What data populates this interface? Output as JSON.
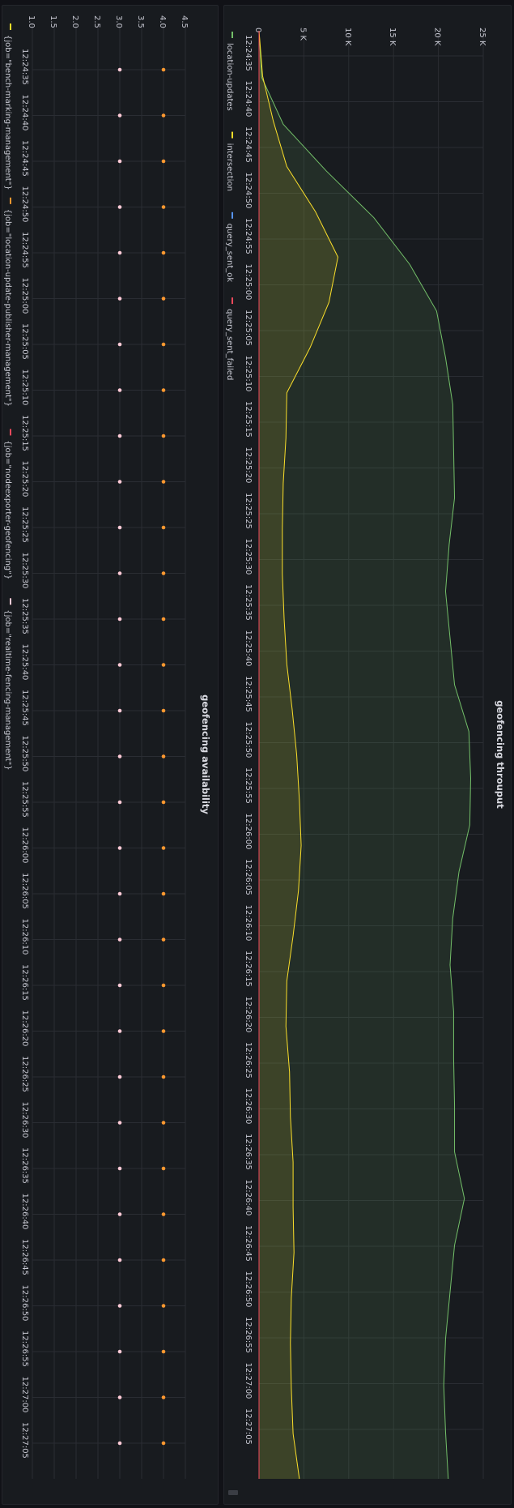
{
  "panels": [
    {
      "title": "geofencing throuput",
      "legend": [
        {
          "label": "location-updates",
          "color": "#73bf69"
        },
        {
          "label": "intersection",
          "color": "#fade2a"
        },
        {
          "label": "query_sent_ok",
          "color": "#5794f2"
        },
        {
          "label": "query_sent_failed",
          "color": "#f2495c"
        }
      ]
    },
    {
      "title": "geofencing availability",
      "legend": [
        {
          "label": "{job=\"bench-marking-management\"}",
          "color": "#fade2a"
        },
        {
          "label": "{job=\"location-update-publisher-management\"}",
          "color": "#ff9830"
        },
        {
          "label": "{job=\"nodeexporter-geofencing\"}",
          "color": "#f2495c"
        },
        {
          "label": "{job=\"realtime-fencing-management\"}",
          "color": "#ffcbd7"
        }
      ]
    }
  ],
  "chart_data": [
    {
      "type": "area",
      "title": "geofencing throuput",
      "x": [
        "12:24:35",
        "12:24:40",
        "12:24:45",
        "12:24:50",
        "12:24:55",
        "12:25:00",
        "12:25:05",
        "12:25:10",
        "12:25:15",
        "12:25:20",
        "12:25:25",
        "12:25:30",
        "12:25:35",
        "12:25:40",
        "12:25:45",
        "12:25:50",
        "12:25:55",
        "12:26:00",
        "12:26:05",
        "12:26:10",
        "12:26:15",
        "12:26:20",
        "12:26:25",
        "12:26:30",
        "12:26:35",
        "12:26:40",
        "12:26:45",
        "12:26:50",
        "12:26:55",
        "12:27:00",
        "12:27:05"
      ],
      "x_ticks": [
        "12:24:35",
        "12:24:40",
        "12:24:45",
        "12:24:50",
        "12:24:55",
        "12:25:00",
        "12:25:05",
        "12:25:10",
        "12:25:15",
        "12:25:20",
        "12:25:25",
        "12:25:30",
        "12:25:35",
        "12:25:40",
        "12:25:45",
        "12:25:50",
        "12:25:55",
        "12:26:00",
        "12:26:05",
        "12:26:10",
        "12:26:15",
        "12:26:20",
        "12:26:25",
        "12:26:30",
        "12:26:35",
        "12:26:40",
        "12:26:45",
        "12:26:50",
        "12:26:55",
        "12:27:00",
        "12:27:05"
      ],
      "y_ticks": [
        "0",
        "5 K",
        "10 K",
        "15 K",
        "20 K",
        "25 K"
      ],
      "ylim": [
        0,
        25000
      ],
      "grid": true,
      "legend_position": "bottom",
      "series": [
        {
          "name": "location-updates",
          "color": "#73bf69",
          "values": [
            0,
            300,
            2700,
            7500,
            12800,
            16800,
            19800,
            20800,
            21600,
            21700,
            21800,
            21200,
            20800,
            21300,
            21800,
            23400,
            23600,
            23500,
            22300,
            21600,
            21300,
            21700,
            21700,
            21800,
            21800,
            22900,
            21800,
            21300,
            20800,
            20600,
            20800,
            21100
          ]
        },
        {
          "name": "intersection",
          "color": "#fade2a",
          "values": [
            0,
            400,
            1600,
            3100,
            6300,
            8800,
            7800,
            5700,
            3100,
            3000,
            2700,
            2600,
            2600,
            2800,
            3100,
            3700,
            4200,
            4500,
            4700,
            4400,
            3800,
            3100,
            3000,
            3400,
            3500,
            3800,
            3800,
            3900,
            3600,
            3500,
            3600,
            3800,
            4500
          ]
        },
        {
          "name": "query_sent_ok",
          "color": "#5794f2",
          "values": []
        },
        {
          "name": "query_sent_failed",
          "color": "#f2495c",
          "values": [
            0,
            0,
            0,
            0,
            0,
            0,
            0,
            0,
            0,
            0,
            0,
            0,
            0,
            0,
            0,
            0,
            0,
            0,
            0,
            0,
            0,
            0,
            0,
            0,
            0,
            0,
            0,
            0,
            0,
            0,
            0,
            0,
            0
          ]
        }
      ]
    },
    {
      "type": "scatter",
      "title": "geofencing availability",
      "x": [
        "12:24:35",
        "12:24:40",
        "12:24:45",
        "12:24:50",
        "12:24:55",
        "12:25:00",
        "12:25:05",
        "12:25:10",
        "12:25:15",
        "12:25:20",
        "12:25:25",
        "12:25:30",
        "12:25:35",
        "12:25:40",
        "12:25:45",
        "12:25:50",
        "12:25:55",
        "12:26:00",
        "12:26:05",
        "12:26:10",
        "12:26:15",
        "12:26:20",
        "12:26:25",
        "12:26:30",
        "12:26:35",
        "12:26:40",
        "12:26:45",
        "12:26:50",
        "12:26:55",
        "12:27:00",
        "12:27:05"
      ],
      "y_ticks": [
        "1.0",
        "1.5",
        "2.0",
        "2.5",
        "3.0",
        "3.5",
        "4.0",
        "4.5"
      ],
      "ylim": [
        1,
        4.5
      ],
      "grid": true,
      "legend_position": "bottom",
      "series": [
        {
          "name": "{job=\"location-update-publisher-management\"}",
          "color": "#ff9830",
          "value": 4
        },
        {
          "name": "{job=\"realtime-fencing-management\"}",
          "color": "#ffcbd7",
          "value": 3
        }
      ]
    }
  ]
}
